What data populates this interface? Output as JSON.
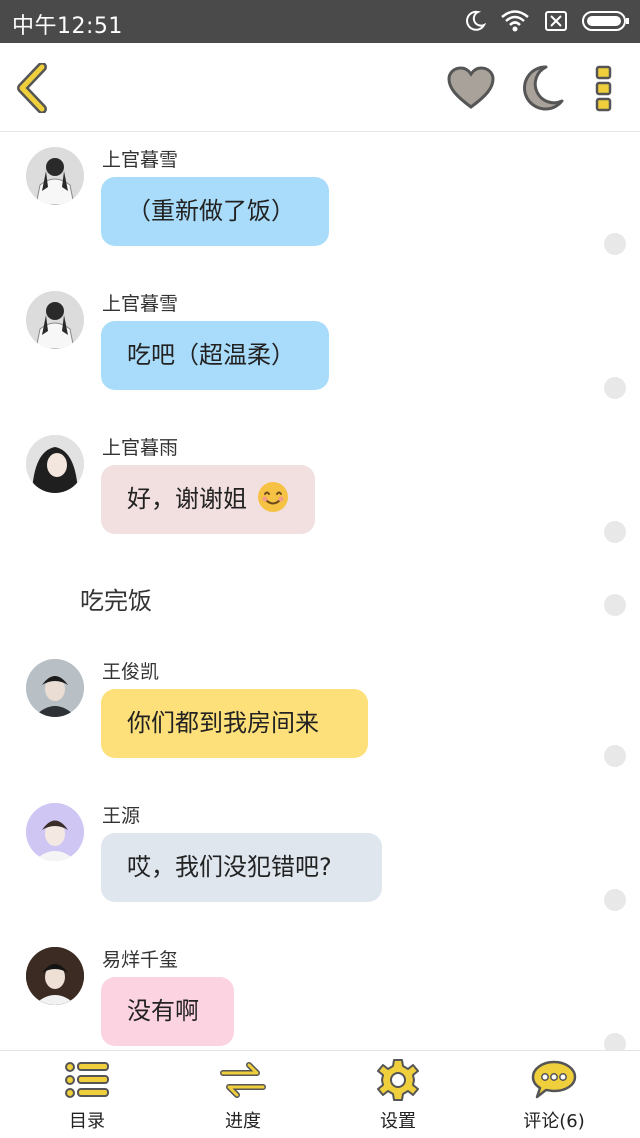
{
  "status_bar": {
    "time": "中午12:51",
    "icons": [
      "moon-icon",
      "wifi-icon",
      "sim-x-icon",
      "battery-icon"
    ]
  },
  "top_bar": {
    "icons": [
      "back-icon",
      "heart-icon",
      "night-mode-icon",
      "more-icon"
    ],
    "accent": "#f0cf3c"
  },
  "messages": [
    {
      "speaker": "上官暮雪",
      "text": "（重新做了饭）",
      "bubble_color": "#a8dcfa"
    },
    {
      "speaker": "上官暮雪",
      "text": "吃吧（超温柔）",
      "bubble_color": "#a8dcfa"
    },
    {
      "speaker": "上官暮雨",
      "text": "好，谢谢姐",
      "emoji": "smiling-face-icon",
      "bubble_color": "#f2dfe0"
    },
    {
      "narration": "吃完饭"
    },
    {
      "speaker": "王俊凯",
      "text": "你们都到我房间来",
      "bubble_color": "#fde07a"
    },
    {
      "speaker": "王源",
      "text": "哎，我们没犯错吧?",
      "bubble_color": "#dfe6ee"
    },
    {
      "speaker": "易烊千玺",
      "text": "没有啊",
      "bubble_color": "#fcd3e0"
    }
  ],
  "bottom_nav": [
    {
      "label": "目录",
      "icon": "list-icon"
    },
    {
      "label": "进度",
      "icon": "swap-arrows-icon"
    },
    {
      "label": "设置",
      "icon": "gear-icon"
    },
    {
      "label": "评论(6)",
      "icon": "comment-icon"
    }
  ]
}
